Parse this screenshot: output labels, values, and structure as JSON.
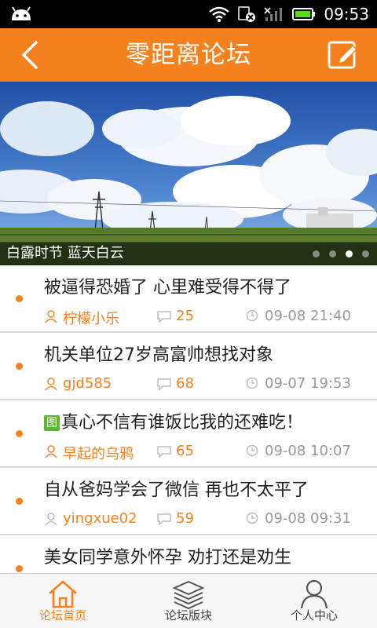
{
  "status_bar": {
    "time": "09:53"
  },
  "header": {
    "title": "零距离论坛"
  },
  "banner": {
    "caption": "白露时节 蓝天白云",
    "slide_count": 4,
    "active_slide": 3
  },
  "posts": [
    {
      "title": "被逼得恐婚了 心里难受得不得了",
      "has_image_tag": false,
      "author": "柠檬小乐",
      "comments": "25",
      "date": "09-08 21:40"
    },
    {
      "title": "机关单位27岁高富帅想找对象",
      "has_image_tag": false,
      "author": "gjd585",
      "comments": "68",
      "date": "09-07 19:53"
    },
    {
      "title": "真心不信有谁饭比我的还难吃！",
      "has_image_tag": true,
      "tag_label": "图",
      "author": "早起的乌鸦",
      "comments": "65",
      "date": "09-08 10:07"
    },
    {
      "title": "自从爸妈学会了微信 再也不太平了",
      "has_image_tag": false,
      "author": "yingxue02",
      "comments": "59",
      "date": "09-08 09:31"
    },
    {
      "title": "美女同学意外怀孕 劝打还是劝生",
      "has_image_tag": false,
      "author": "",
      "comments": "",
      "date": ""
    }
  ],
  "bottom_nav": {
    "items": [
      {
        "label": "论坛首页",
        "icon": "home-icon",
        "active": true
      },
      {
        "label": "论坛版块",
        "icon": "layers-icon",
        "active": false
      },
      {
        "label": "个人中心",
        "icon": "person-icon",
        "active": false
      }
    ]
  },
  "colors": {
    "accent": "#f5821f",
    "tag_green": "#5cb531",
    "meta_gray": "#999999"
  }
}
